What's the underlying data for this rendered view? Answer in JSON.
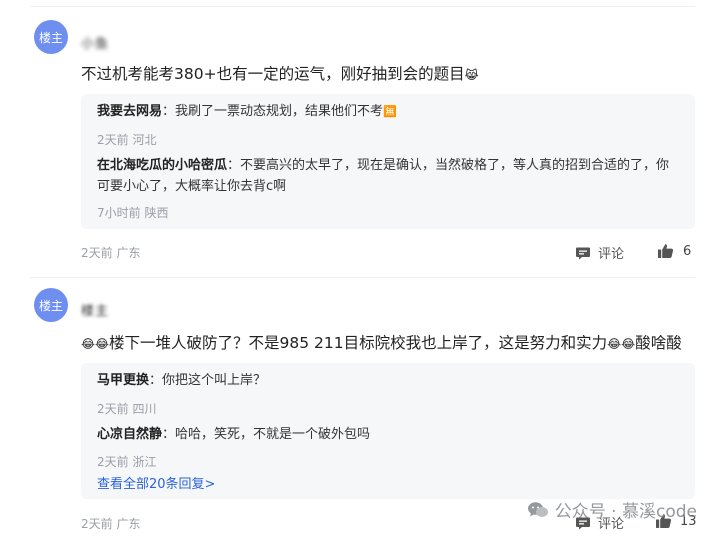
{
  "comments": [
    {
      "avatar_label": "楼主",
      "username": "小鱼",
      "content": "不过机考能考380+也有一定的运气，刚好抽到会的题目",
      "content_emoji": "😹",
      "replies": [
        {
          "name": "我要去网易",
          "text": "我刷了一票动态规划，结果他们不考",
          "emoji": "🈚",
          "meta": "2天前 河北"
        },
        {
          "name": "在北海吃瓜的小哈密瓜",
          "text": "不要高兴的太早了，现在是确认，当然破格了，等人真的招到合适的了，你可要小心了，大概率让你去背c啊",
          "meta": "7小时前 陕西"
        }
      ],
      "meta": "2天前 广东",
      "comment_label": "评论",
      "like_count": "6"
    },
    {
      "avatar_label": "楼主",
      "username": "楼主",
      "content_prefix_emoji": "😂😂",
      "content": "楼下一堆人破防了？不是985 211目标院校我也上岸了，这是努力和实力",
      "content_suffix_emoji": "😂😂",
      "content_tail": "酸啥酸",
      "replies": [
        {
          "name": "马甲更换",
          "text": "你把这个叫上岸？",
          "meta": "2天前 四川"
        },
        {
          "name": "心凉自然静",
          "text": "哈哈，笑死，不就是一个破外包吗",
          "meta": "2天前 浙江"
        }
      ],
      "view_all": "查看全部20条回复>",
      "meta": "2天前 广东",
      "comment_label": "评论",
      "like_count": "13"
    }
  ],
  "watermark": "公众号 · 慕溪code"
}
